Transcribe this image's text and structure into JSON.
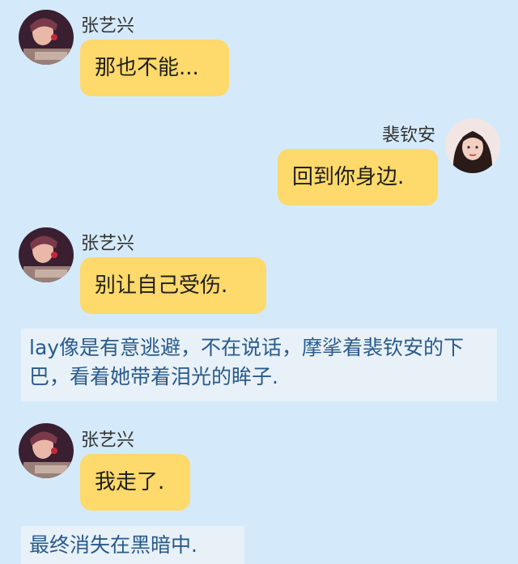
{
  "chat": {
    "messages": [
      {
        "sender": "张艺兴",
        "side": "left",
        "text": "那也不能..."
      },
      {
        "sender": "裴钦安",
        "side": "right",
        "text": "回到你身边."
      },
      {
        "sender": "张艺兴",
        "side": "left",
        "text": "别让自己受伤."
      },
      {
        "sender": "张艺兴",
        "side": "left",
        "text": "我走了."
      }
    ],
    "narrations": [
      {
        "text": "lay像是有意逃避，不在说话，摩挲着裴钦安的下巴，看着她带着泪光的眸子."
      },
      {
        "text": "最终消失在黑暗中."
      }
    ]
  },
  "colors": {
    "background": "#d4eafa",
    "bubble": "#fed96b",
    "narration_bg": "#e8f1f8",
    "narration_text": "#2a5a8a"
  }
}
